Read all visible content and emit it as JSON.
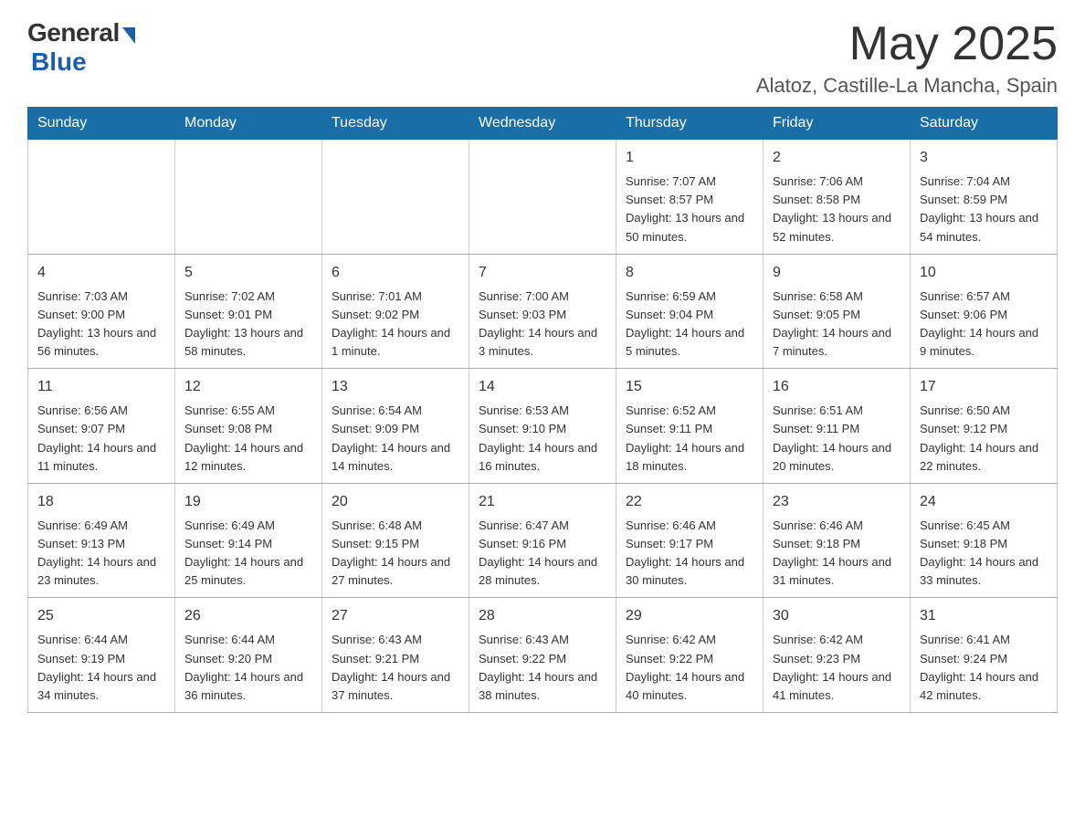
{
  "header": {
    "logo_general": "General",
    "logo_blue": "Blue",
    "month_title": "May 2025",
    "location": "Alatoz, Castille-La Mancha, Spain"
  },
  "days_of_week": [
    "Sunday",
    "Monday",
    "Tuesday",
    "Wednesday",
    "Thursday",
    "Friday",
    "Saturday"
  ],
  "weeks": [
    [
      {
        "day": "",
        "info": ""
      },
      {
        "day": "",
        "info": ""
      },
      {
        "day": "",
        "info": ""
      },
      {
        "day": "",
        "info": ""
      },
      {
        "day": "1",
        "info": "Sunrise: 7:07 AM\nSunset: 8:57 PM\nDaylight: 13 hours and 50 minutes."
      },
      {
        "day": "2",
        "info": "Sunrise: 7:06 AM\nSunset: 8:58 PM\nDaylight: 13 hours and 52 minutes."
      },
      {
        "day": "3",
        "info": "Sunrise: 7:04 AM\nSunset: 8:59 PM\nDaylight: 13 hours and 54 minutes."
      }
    ],
    [
      {
        "day": "4",
        "info": "Sunrise: 7:03 AM\nSunset: 9:00 PM\nDaylight: 13 hours and 56 minutes."
      },
      {
        "day": "5",
        "info": "Sunrise: 7:02 AM\nSunset: 9:01 PM\nDaylight: 13 hours and 58 minutes."
      },
      {
        "day": "6",
        "info": "Sunrise: 7:01 AM\nSunset: 9:02 PM\nDaylight: 14 hours and 1 minute."
      },
      {
        "day": "7",
        "info": "Sunrise: 7:00 AM\nSunset: 9:03 PM\nDaylight: 14 hours and 3 minutes."
      },
      {
        "day": "8",
        "info": "Sunrise: 6:59 AM\nSunset: 9:04 PM\nDaylight: 14 hours and 5 minutes."
      },
      {
        "day": "9",
        "info": "Sunrise: 6:58 AM\nSunset: 9:05 PM\nDaylight: 14 hours and 7 minutes."
      },
      {
        "day": "10",
        "info": "Sunrise: 6:57 AM\nSunset: 9:06 PM\nDaylight: 14 hours and 9 minutes."
      }
    ],
    [
      {
        "day": "11",
        "info": "Sunrise: 6:56 AM\nSunset: 9:07 PM\nDaylight: 14 hours and 11 minutes."
      },
      {
        "day": "12",
        "info": "Sunrise: 6:55 AM\nSunset: 9:08 PM\nDaylight: 14 hours and 12 minutes."
      },
      {
        "day": "13",
        "info": "Sunrise: 6:54 AM\nSunset: 9:09 PM\nDaylight: 14 hours and 14 minutes."
      },
      {
        "day": "14",
        "info": "Sunrise: 6:53 AM\nSunset: 9:10 PM\nDaylight: 14 hours and 16 minutes."
      },
      {
        "day": "15",
        "info": "Sunrise: 6:52 AM\nSunset: 9:11 PM\nDaylight: 14 hours and 18 minutes."
      },
      {
        "day": "16",
        "info": "Sunrise: 6:51 AM\nSunset: 9:11 PM\nDaylight: 14 hours and 20 minutes."
      },
      {
        "day": "17",
        "info": "Sunrise: 6:50 AM\nSunset: 9:12 PM\nDaylight: 14 hours and 22 minutes."
      }
    ],
    [
      {
        "day": "18",
        "info": "Sunrise: 6:49 AM\nSunset: 9:13 PM\nDaylight: 14 hours and 23 minutes."
      },
      {
        "day": "19",
        "info": "Sunrise: 6:49 AM\nSunset: 9:14 PM\nDaylight: 14 hours and 25 minutes."
      },
      {
        "day": "20",
        "info": "Sunrise: 6:48 AM\nSunset: 9:15 PM\nDaylight: 14 hours and 27 minutes."
      },
      {
        "day": "21",
        "info": "Sunrise: 6:47 AM\nSunset: 9:16 PM\nDaylight: 14 hours and 28 minutes."
      },
      {
        "day": "22",
        "info": "Sunrise: 6:46 AM\nSunset: 9:17 PM\nDaylight: 14 hours and 30 minutes."
      },
      {
        "day": "23",
        "info": "Sunrise: 6:46 AM\nSunset: 9:18 PM\nDaylight: 14 hours and 31 minutes."
      },
      {
        "day": "24",
        "info": "Sunrise: 6:45 AM\nSunset: 9:18 PM\nDaylight: 14 hours and 33 minutes."
      }
    ],
    [
      {
        "day": "25",
        "info": "Sunrise: 6:44 AM\nSunset: 9:19 PM\nDaylight: 14 hours and 34 minutes."
      },
      {
        "day": "26",
        "info": "Sunrise: 6:44 AM\nSunset: 9:20 PM\nDaylight: 14 hours and 36 minutes."
      },
      {
        "day": "27",
        "info": "Sunrise: 6:43 AM\nSunset: 9:21 PM\nDaylight: 14 hours and 37 minutes."
      },
      {
        "day": "28",
        "info": "Sunrise: 6:43 AM\nSunset: 9:22 PM\nDaylight: 14 hours and 38 minutes."
      },
      {
        "day": "29",
        "info": "Sunrise: 6:42 AM\nSunset: 9:22 PM\nDaylight: 14 hours and 40 minutes."
      },
      {
        "day": "30",
        "info": "Sunrise: 6:42 AM\nSunset: 9:23 PM\nDaylight: 14 hours and 41 minutes."
      },
      {
        "day": "31",
        "info": "Sunrise: 6:41 AM\nSunset: 9:24 PM\nDaylight: 14 hours and 42 minutes."
      }
    ]
  ]
}
